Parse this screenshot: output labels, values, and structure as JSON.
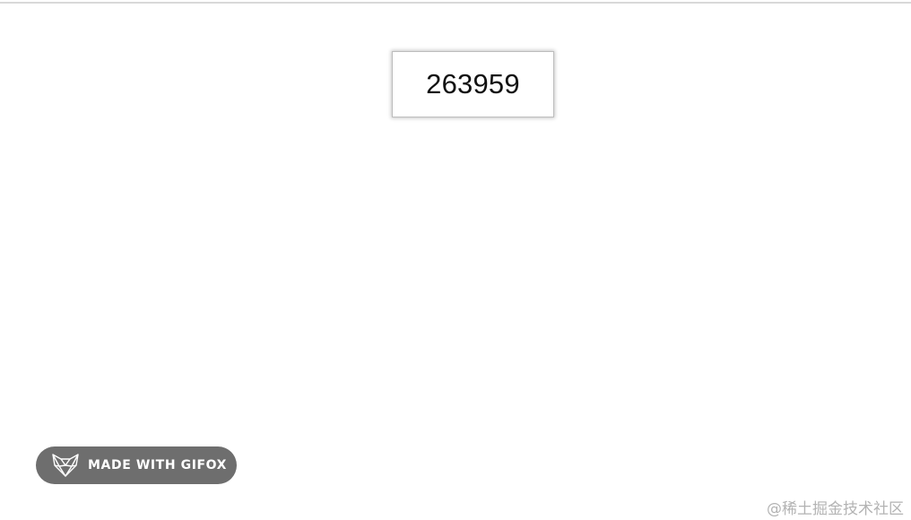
{
  "counter": {
    "value": "263959"
  },
  "badge": {
    "label": "MADE WITH GIFOX",
    "icon": "fox-icon",
    "background": "#6e6e6e"
  },
  "watermark": {
    "text": "@稀土掘金技术社区"
  }
}
